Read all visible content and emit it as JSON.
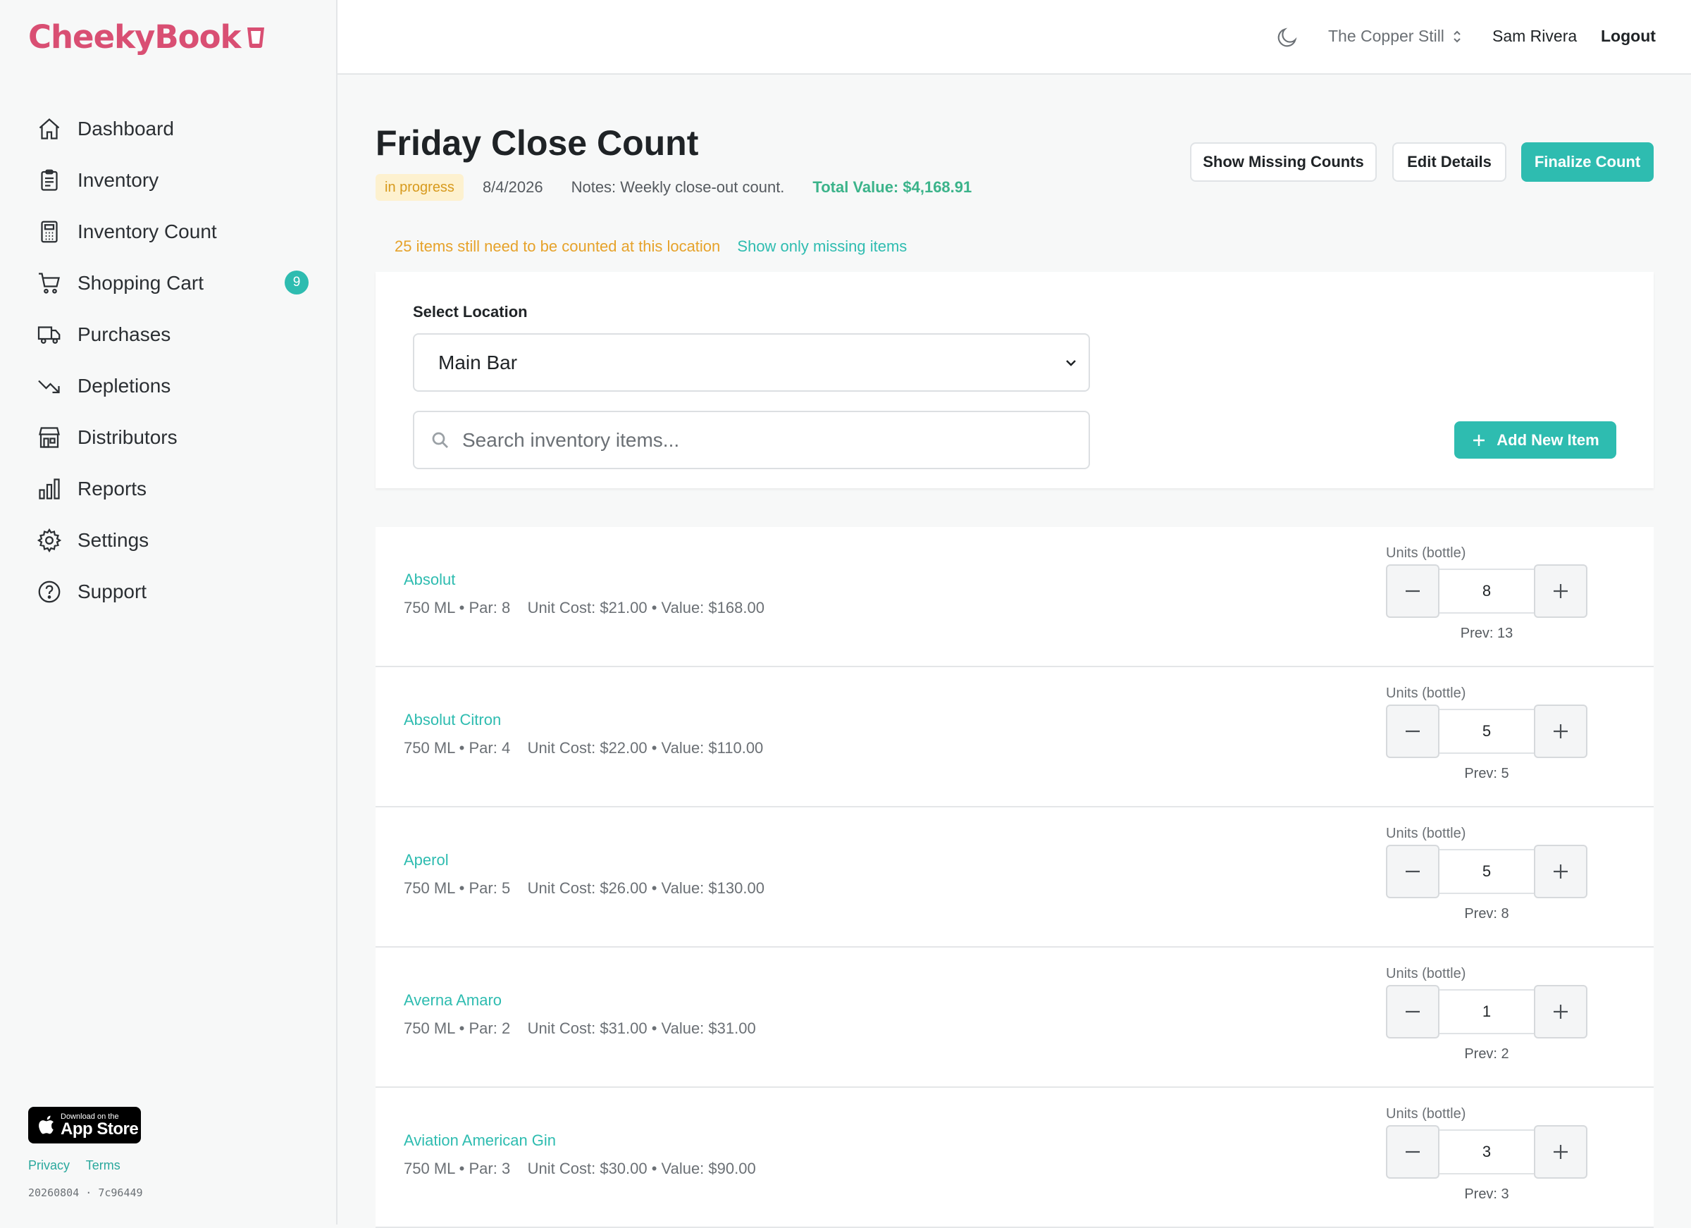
{
  "app": {
    "brand": "CheekyBook"
  },
  "sidebar": {
    "items": [
      {
        "label": "Dashboard",
        "icon": "home-icon"
      },
      {
        "label": "Inventory",
        "icon": "clipboard-icon"
      },
      {
        "label": "Inventory Count",
        "icon": "calculator-icon"
      },
      {
        "label": "Shopping Cart",
        "icon": "cart-icon",
        "badge": "9"
      },
      {
        "label": "Purchases",
        "icon": "truck-icon"
      },
      {
        "label": "Depletions",
        "icon": "trending-down-icon"
      },
      {
        "label": "Distributors",
        "icon": "store-icon"
      },
      {
        "label": "Reports",
        "icon": "bar-chart-icon"
      },
      {
        "label": "Settings",
        "icon": "gear-icon"
      },
      {
        "label": "Support",
        "icon": "question-icon"
      }
    ],
    "appstore": {
      "small": "Download on the",
      "big": "App Store"
    },
    "privacy": "Privacy",
    "terms": "Terms",
    "build": "20260804 · 7c96449"
  },
  "topbar": {
    "venue": "The Copper Still",
    "user": "Sam Rivera",
    "logout": "Logout"
  },
  "header": {
    "title": "Friday Close Count",
    "status": "in progress",
    "date": "8/4/2026",
    "notes": "Notes: Weekly close-out count.",
    "total": "Total Value: $4,168.91",
    "btn_missing": "Show Missing Counts",
    "btn_edit": "Edit Details",
    "btn_finalize": "Finalize Count"
  },
  "warning": {
    "text": "25 items still need to be counted at this location",
    "link": "Show only missing items"
  },
  "location": {
    "label": "Select Location",
    "selected": "Main Bar",
    "search_placeholder": "Search inventory items...",
    "add_button": "Add New Item"
  },
  "items": [
    {
      "name": "Absolut",
      "detail": "750 ML • Par: 8    Unit Cost: $21.00 • Value: $168.00",
      "unit_label": "Units (bottle)",
      "count": "8",
      "prev": "Prev: 13"
    },
    {
      "name": "Absolut Citron",
      "detail": "750 ML • Par: 4    Unit Cost: $22.00 • Value: $110.00",
      "unit_label": "Units (bottle)",
      "count": "5",
      "prev": "Prev: 5"
    },
    {
      "name": "Aperol",
      "detail": "750 ML • Par: 5    Unit Cost: $26.00 • Value: $130.00",
      "unit_label": "Units (bottle)",
      "count": "5",
      "prev": "Prev: 8"
    },
    {
      "name": "Averna Amaro",
      "detail": "750 ML • Par: 2    Unit Cost: $31.00 • Value: $31.00",
      "unit_label": "Units (bottle)",
      "count": "1",
      "prev": "Prev: 2"
    },
    {
      "name": "Aviation American Gin",
      "detail": "750 ML • Par: 3    Unit Cost: $30.00 • Value: $90.00",
      "unit_label": "Units (bottle)",
      "count": "3",
      "prev": "Prev: 3"
    }
  ],
  "colors": {
    "brand": "#d94f73",
    "accent": "#2ebcb0",
    "warning": "#e6a22a",
    "total": "#3bb38a"
  }
}
